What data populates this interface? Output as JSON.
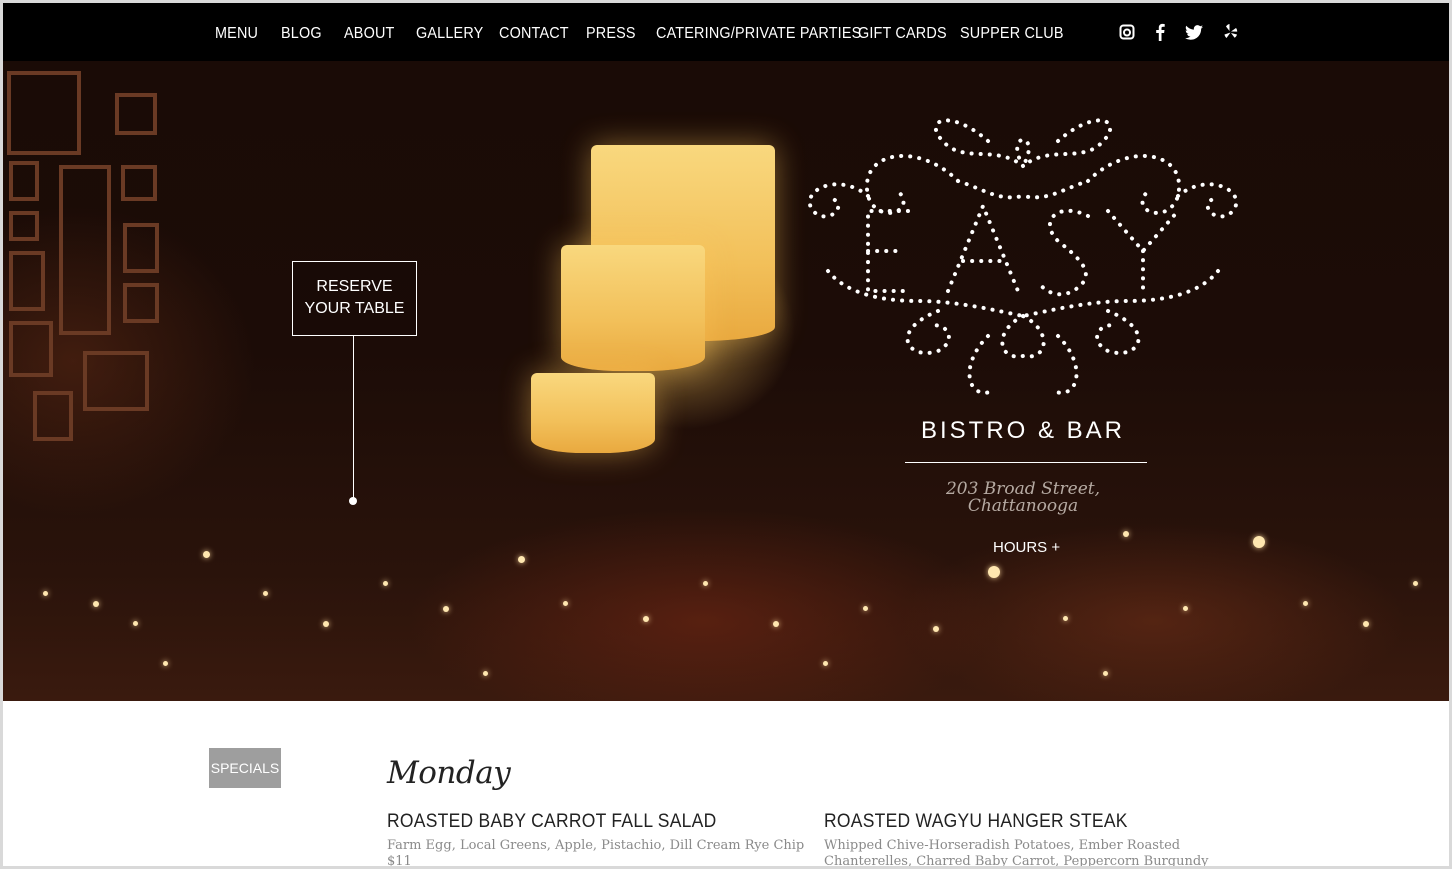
{
  "nav": {
    "items": [
      "MENU",
      "BLOG",
      "ABOUT",
      "GALLERY",
      "CONTACT",
      "PRESS",
      "CATERING/PRIVATE PARTIES",
      "GIFT CARDS",
      "SUPPER CLUB"
    ],
    "social_icons": [
      "instagram-icon",
      "facebook-icon",
      "twitter-icon",
      "yelp-icon"
    ]
  },
  "hero": {
    "reserve_line1": "RESERVE",
    "reserve_line2": "YOUR TABLE",
    "logo_text": "EASY",
    "subtitle": "BISTRO & BAR",
    "address_line1": "203 Broad Street,",
    "address_line2": "Chattanooga",
    "hours_label": "HOURS +"
  },
  "specials": {
    "tab_label": "SPECIALS",
    "day": "Monday",
    "dishes": [
      {
        "name": "ROASTED BABY CARROT FALL SALAD",
        "description": "Farm Egg, Local Greens, Apple, Pistachio, Dill Cream Rye Chip",
        "price": "$11"
      },
      {
        "name": "ROASTED WAGYU HANGER STEAK",
        "description": "Whipped Chive-Horseradish Potatoes, Ember Roasted Chanterelles, Charred Baby Carrot, Peppercorn Burgundy Truffle Jus"
      }
    ]
  },
  "colors": {
    "nav_bg": "#000000",
    "specials_tab": "#9e9e9e",
    "lamp": "#f2c05a"
  }
}
